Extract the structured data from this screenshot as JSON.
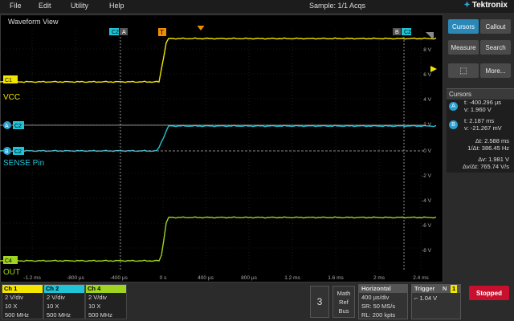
{
  "menu": {
    "items": [
      "File",
      "Edit",
      "Utility",
      "Help"
    ],
    "sample": "Sample: 1/1 Acqs",
    "brand": "Tektronix"
  },
  "waveform_view": {
    "title": "Waveform View"
  },
  "channel_labels": {
    "c1": "C1",
    "c2": "C2",
    "c4": "C4",
    "vcc": "VCC",
    "sense": "SENSE Pin",
    "out": "OUT",
    "cursor_a": "A",
    "cursor_b": "B",
    "trigger": "T"
  },
  "y_ticks": [
    "8 V",
    "6 V",
    "4 V",
    "2 V",
    "0 V",
    "-2 V",
    "-4 V",
    "-6 V",
    "-8 V"
  ],
  "x_ticks": [
    "-1.2 ms",
    "-800 µs",
    "-400 µs",
    "0 s",
    "400 µs",
    "800 µs",
    "1.2 ms",
    "1.6 ms",
    "2 ms",
    "2.4 ms"
  ],
  "side": {
    "cursors": "Cursors",
    "callout": "Callout",
    "measure": "Measure",
    "search": "Search",
    "more": "More..."
  },
  "cursors_panel": {
    "title": "Cursors",
    "a_t": "t: -400.296 µs",
    "a_v": "v: 1.960 V",
    "b_t": "t: 2.187 ms",
    "b_v": "v: -21.267 mV",
    "dt": "Δt: 2.588 ms",
    "inv_dt": "1/Δt: 386.45 Hz",
    "dv": "Δv: 1.981 V",
    "dvdt": "Δv/Δt: 765.74 V/s"
  },
  "channels": [
    {
      "name": "Ch 1",
      "scale": "2 V/div",
      "probe": "10 X",
      "bw": "500 MHz",
      "color": "#f2e600"
    },
    {
      "name": "Ch 2",
      "scale": "2 V/div",
      "probe": "10 X",
      "bw": "500 MHz",
      "color": "#21c4d6"
    },
    {
      "name": "Ch 4",
      "scale": "2 V/div",
      "probe": "10 X",
      "bw": "500 MHz",
      "color": "#9fd420"
    }
  ],
  "bottom": {
    "add_count": "3",
    "math": "Math",
    "ref": "Ref",
    "bus": "Bus",
    "horizontal_title": "Horizontal",
    "h1": "400 µs/div",
    "h2": "SR: 50 MS/s",
    "h3": "RL: 200 kpts",
    "trigger_title": "Trigger",
    "trigger_mode": "N",
    "trigger_ch": "1",
    "trigger_level": "1.04 V",
    "status": "Stopped"
  },
  "colors": {
    "ch1": "#f2e600",
    "ch2": "#21c4d6",
    "ch4": "#9fd420",
    "accent": "#2a88b8",
    "status": "#c8102e"
  }
}
